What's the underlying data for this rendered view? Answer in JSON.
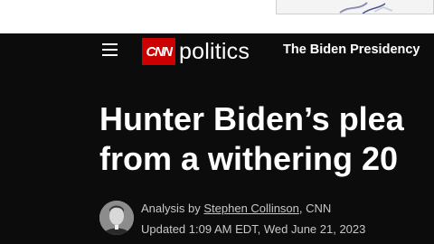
{
  "header": {
    "logo_text": "CNN",
    "section_name": "politics",
    "section_link": "The Biden Presidency"
  },
  "article": {
    "headline_line1": "Hunter Biden’s plea",
    "headline_line2": "from a withering 20",
    "byline_prefix": "Analysis by",
    "author": "Stephen Collinson",
    "byline_suffix": ", CNN",
    "updated": "Updated 1:09 AM EDT, Wed June 21, 2023"
  },
  "colors": {
    "background": "#0c0c0c",
    "brand_red": "#cc0000",
    "text": "#ffffff",
    "meta_text": "#c7c7c7"
  }
}
